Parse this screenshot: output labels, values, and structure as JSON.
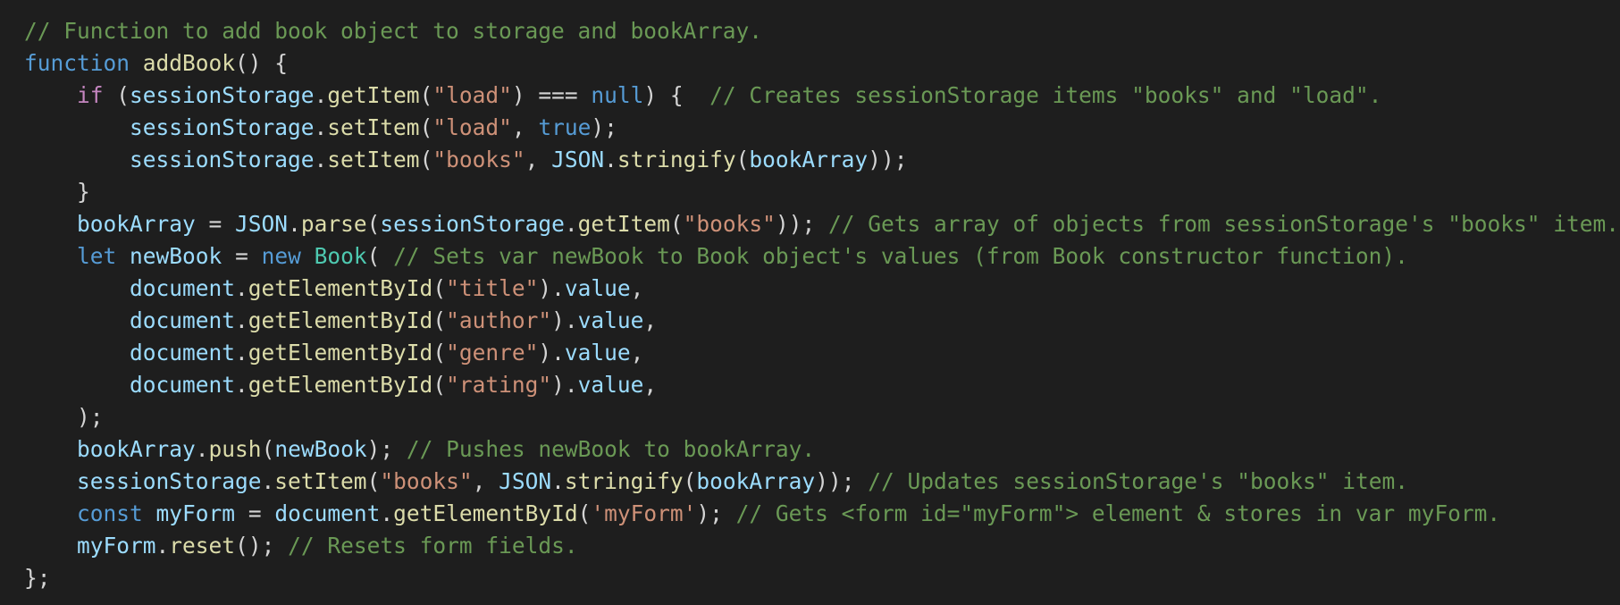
{
  "editor": {
    "theme_colors": {
      "background": "#1e1e1e",
      "comment": "#6a9955",
      "keyword": "#569cd6",
      "control": "#c586c0",
      "function": "#dcdcaa",
      "variable": "#9cdcfe",
      "string": "#ce9178",
      "type": "#4ec9b0",
      "punctuation": "#d4d4d4"
    },
    "lines": [
      [
        [
          "c",
          "// Function to add book object to storage and bookArray."
        ]
      ],
      [
        [
          "k",
          "function"
        ],
        [
          "p",
          " "
        ],
        [
          "f",
          "addBook"
        ],
        [
          "p",
          "() {"
        ]
      ],
      [
        [
          "p",
          "    "
        ],
        [
          "kc",
          "if"
        ],
        [
          "p",
          " ("
        ],
        [
          "v",
          "sessionStorage"
        ],
        [
          "p",
          "."
        ],
        [
          "f",
          "getItem"
        ],
        [
          "p",
          "("
        ],
        [
          "s",
          "\"load\""
        ],
        [
          "p",
          ") === "
        ],
        [
          "k",
          "null"
        ],
        [
          "p",
          ") {  "
        ],
        [
          "c",
          "// Creates sessionStorage items \"books\" and \"load\"."
        ]
      ],
      [
        [
          "p",
          "        "
        ],
        [
          "v",
          "sessionStorage"
        ],
        [
          "p",
          "."
        ],
        [
          "f",
          "setItem"
        ],
        [
          "p",
          "("
        ],
        [
          "s",
          "\"load\""
        ],
        [
          "p",
          ", "
        ],
        [
          "k",
          "true"
        ],
        [
          "p",
          ");"
        ]
      ],
      [
        [
          "p",
          "        "
        ],
        [
          "v",
          "sessionStorage"
        ],
        [
          "p",
          "."
        ],
        [
          "f",
          "setItem"
        ],
        [
          "p",
          "("
        ],
        [
          "s",
          "\"books\""
        ],
        [
          "p",
          ", "
        ],
        [
          "v",
          "JSON"
        ],
        [
          "p",
          "."
        ],
        [
          "f",
          "stringify"
        ],
        [
          "p",
          "("
        ],
        [
          "v",
          "bookArray"
        ],
        [
          "p",
          "));"
        ]
      ],
      [
        [
          "p",
          "    }"
        ]
      ],
      [
        [
          "p",
          "    "
        ],
        [
          "v",
          "bookArray"
        ],
        [
          "p",
          " = "
        ],
        [
          "v",
          "JSON"
        ],
        [
          "p",
          "."
        ],
        [
          "f",
          "parse"
        ],
        [
          "p",
          "("
        ],
        [
          "v",
          "sessionStorage"
        ],
        [
          "p",
          "."
        ],
        [
          "f",
          "getItem"
        ],
        [
          "p",
          "("
        ],
        [
          "s",
          "\"books\""
        ],
        [
          "p",
          ")); "
        ],
        [
          "c",
          "// Gets array of objects from sessionStorage's \"books\" item."
        ]
      ],
      [
        [
          "p",
          "    "
        ],
        [
          "k",
          "let"
        ],
        [
          "p",
          " "
        ],
        [
          "v",
          "newBook"
        ],
        [
          "p",
          " = "
        ],
        [
          "k",
          "new"
        ],
        [
          "p",
          " "
        ],
        [
          "t",
          "Book"
        ],
        [
          "p",
          "( "
        ],
        [
          "c",
          "// Sets var newBook to Book object's values (from Book constructor function)."
        ]
      ],
      [
        [
          "p",
          "        "
        ],
        [
          "v",
          "document"
        ],
        [
          "p",
          "."
        ],
        [
          "f",
          "getElementById"
        ],
        [
          "p",
          "("
        ],
        [
          "s",
          "\"title\""
        ],
        [
          "p",
          ")."
        ],
        [
          "v",
          "value"
        ],
        [
          "p",
          ","
        ]
      ],
      [
        [
          "p",
          "        "
        ],
        [
          "v",
          "document"
        ],
        [
          "p",
          "."
        ],
        [
          "f",
          "getElementById"
        ],
        [
          "p",
          "("
        ],
        [
          "s",
          "\"author\""
        ],
        [
          "p",
          ")."
        ],
        [
          "v",
          "value"
        ],
        [
          "p",
          ","
        ]
      ],
      [
        [
          "p",
          "        "
        ],
        [
          "v",
          "document"
        ],
        [
          "p",
          "."
        ],
        [
          "f",
          "getElementById"
        ],
        [
          "p",
          "("
        ],
        [
          "s",
          "\"genre\""
        ],
        [
          "p",
          ")."
        ],
        [
          "v",
          "value"
        ],
        [
          "p",
          ","
        ]
      ],
      [
        [
          "p",
          "        "
        ],
        [
          "v",
          "document"
        ],
        [
          "p",
          "."
        ],
        [
          "f",
          "getElementById"
        ],
        [
          "p",
          "("
        ],
        [
          "s",
          "\"rating\""
        ],
        [
          "p",
          ")."
        ],
        [
          "v",
          "value"
        ],
        [
          "p",
          ","
        ]
      ],
      [
        [
          "p",
          "    );"
        ]
      ],
      [
        [
          "p",
          "    "
        ],
        [
          "v",
          "bookArray"
        ],
        [
          "p",
          "."
        ],
        [
          "f",
          "push"
        ],
        [
          "p",
          "("
        ],
        [
          "v",
          "newBook"
        ],
        [
          "p",
          "); "
        ],
        [
          "c",
          "// Pushes newBook to bookArray."
        ]
      ],
      [
        [
          "p",
          "    "
        ],
        [
          "v",
          "sessionStorage"
        ],
        [
          "p",
          "."
        ],
        [
          "f",
          "setItem"
        ],
        [
          "p",
          "("
        ],
        [
          "s",
          "\"books\""
        ],
        [
          "p",
          ", "
        ],
        [
          "v",
          "JSON"
        ],
        [
          "p",
          "."
        ],
        [
          "f",
          "stringify"
        ],
        [
          "p",
          "("
        ],
        [
          "v",
          "bookArray"
        ],
        [
          "p",
          ")); "
        ],
        [
          "c",
          "// Updates sessionStorage's \"books\" item."
        ]
      ],
      [
        [
          "p",
          "    "
        ],
        [
          "k",
          "const"
        ],
        [
          "p",
          " "
        ],
        [
          "v",
          "myForm"
        ],
        [
          "p",
          " = "
        ],
        [
          "v",
          "document"
        ],
        [
          "p",
          "."
        ],
        [
          "f",
          "getElementById"
        ],
        [
          "p",
          "("
        ],
        [
          "s",
          "'myForm'"
        ],
        [
          "p",
          "); "
        ],
        [
          "c",
          "// Gets <form id=\"myForm\"> element & stores in var myForm."
        ]
      ],
      [
        [
          "p",
          "    "
        ],
        [
          "v",
          "myForm"
        ],
        [
          "p",
          "."
        ],
        [
          "f",
          "reset"
        ],
        [
          "p",
          "(); "
        ],
        [
          "c",
          "// Resets form fields."
        ]
      ],
      [
        [
          "p",
          "};"
        ]
      ]
    ]
  }
}
